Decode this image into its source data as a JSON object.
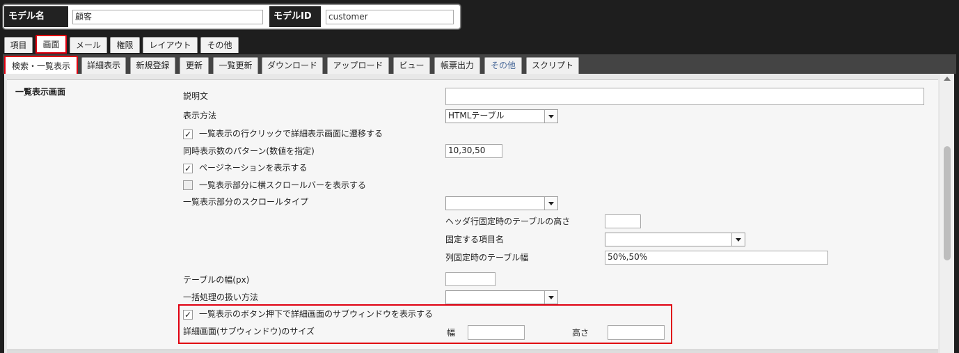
{
  "header": {
    "model_name_label": "モデル名",
    "model_name_value": "顧客",
    "model_id_label": "モデルID",
    "model_id_value": "customer"
  },
  "main_tabs": [
    "項目",
    "画面",
    "メール",
    "権限",
    "レイアウト",
    "その他"
  ],
  "sub_tabs": [
    "検索・一覧表示",
    "詳細表示",
    "新規登録",
    "更新",
    "一覧更新",
    "ダウンロード",
    "アップロード",
    "ビュー",
    "帳票出力",
    "その他",
    "スクリプト"
  ],
  "section": {
    "title": "一覧表示画面",
    "description_label": "説明文",
    "description_value": "",
    "display_method_label": "表示方法",
    "display_method_value": "HTMLテーブル",
    "row_click_label": "一覧表示の行クリックで詳細表示画面に遷移する",
    "row_click_checked": true,
    "page_pattern_label": "同時表示数のパターン(数値を指定)",
    "page_pattern_value": "10,30,50",
    "pagination_label": "ページネーションを表示する",
    "pagination_checked": true,
    "hscroll_label": "一覧表示部分に横スクロールバーを表示する",
    "hscroll_checked": false,
    "scroll_type_label": "一覧表示部分のスクロールタイプ",
    "scroll_type_value": "",
    "header_height_label": "ヘッダ行固定時のテーブルの高さ",
    "header_height_value": "",
    "fixed_item_label": "固定する項目名",
    "fixed_item_value": "",
    "col_width_label": "列固定時のテーブル幅",
    "col_width_value": "50%,50%",
    "table_width_label": "テーブルの幅(px)",
    "table_width_value": "",
    "bulk_label": "一括処理の扱い方法",
    "bulk_value": "",
    "subwindow_label": "一覧表示のボタン押下で詳細画面のサブウィンドウを表示する",
    "subwindow_checked": true,
    "subwindow_size_label": "詳細画面(サブウィンドウ)のサイズ",
    "width_label": "幅",
    "width_value": "",
    "height_label": "高さ",
    "height_value": ""
  },
  "colors": {
    "highlight": "#e00010",
    "accent_tab": "#4a6a9a"
  }
}
